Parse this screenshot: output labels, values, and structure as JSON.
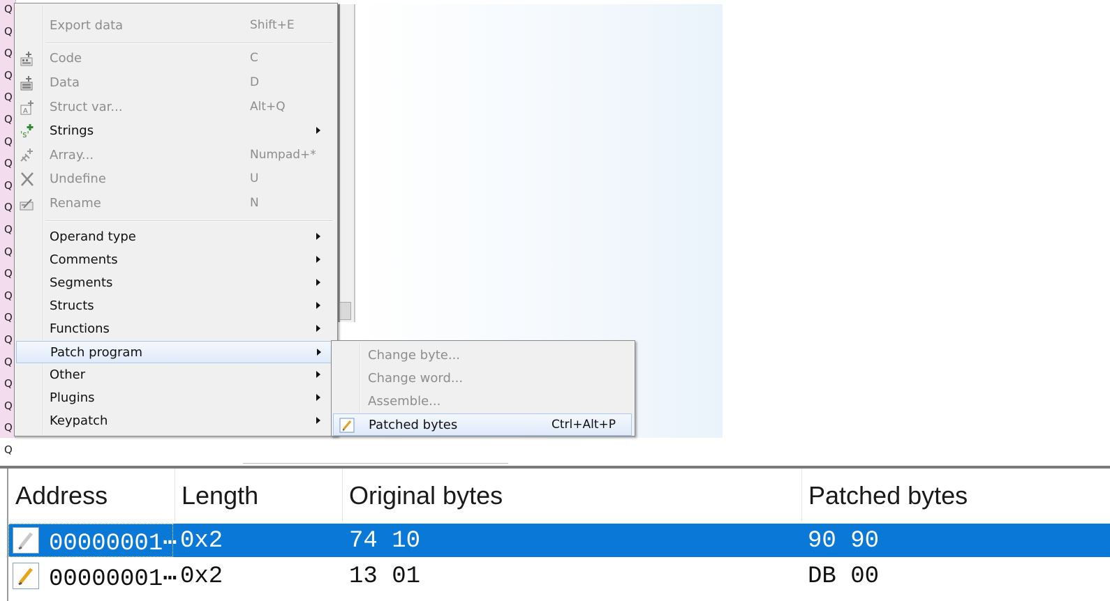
{
  "left_strip": {
    "glyph": "Q",
    "count": 21
  },
  "context_menu": {
    "items": [
      {
        "label": "Export data",
        "shortcut": "Shift+E",
        "disabled": true,
        "icon": ""
      },
      {
        "label": "Code",
        "shortcut": "C",
        "disabled": true,
        "icon": "code-icon"
      },
      {
        "label": "Data",
        "shortcut": "D",
        "disabled": true,
        "icon": "data-icon"
      },
      {
        "label": "Struct var...",
        "shortcut": "Alt+Q",
        "disabled": true,
        "icon": "struct-var-icon"
      },
      {
        "label": "Strings",
        "shortcut": "",
        "submenu": true,
        "icon": "strings-icon"
      },
      {
        "label": "Array...",
        "shortcut": "Numpad+*",
        "disabled": true,
        "icon": "array-icon"
      },
      {
        "label": "Undefine",
        "shortcut": "U",
        "disabled": true,
        "icon": "undefine-icon"
      },
      {
        "label": "Rename",
        "shortcut": "N",
        "disabled": true,
        "icon": "rename-icon"
      },
      {
        "label": "Operand type",
        "submenu": true
      },
      {
        "label": "Comments",
        "submenu": true
      },
      {
        "label": "Segments",
        "submenu": true
      },
      {
        "label": "Structs",
        "submenu": true
      },
      {
        "label": "Functions",
        "submenu": true
      },
      {
        "label": "Patch program",
        "submenu": true,
        "highlighted": true
      },
      {
        "label": "Other",
        "submenu": true
      },
      {
        "label": "Plugins",
        "submenu": true
      },
      {
        "label": "Keypatch",
        "submenu": true
      }
    ]
  },
  "patch_submenu": {
    "items": [
      {
        "label": "Change byte...",
        "disabled": true
      },
      {
        "label": "Change word...",
        "disabled": true
      },
      {
        "label": "Assemble...",
        "disabled": true
      },
      {
        "label": "Patched bytes",
        "shortcut": "Ctrl+Alt+P",
        "highlighted": true,
        "icon": "patched-bytes-icon"
      }
    ]
  },
  "patched_table": {
    "columns": [
      "Address",
      "Length",
      "Original bytes",
      "Patched bytes"
    ],
    "rows": [
      {
        "address": "00000001⋯",
        "length": "0x2",
        "original": "74 10",
        "patched": "90 90",
        "selected": true
      },
      {
        "address": "00000001⋯",
        "length": "0x2",
        "original": "13 01",
        "patched": "DB 00",
        "selected": false
      }
    ]
  },
  "colors": {
    "selection": "#0a78d7",
    "menu_bg": "#f0f0f0",
    "highlight_border": "#aac8ee"
  }
}
